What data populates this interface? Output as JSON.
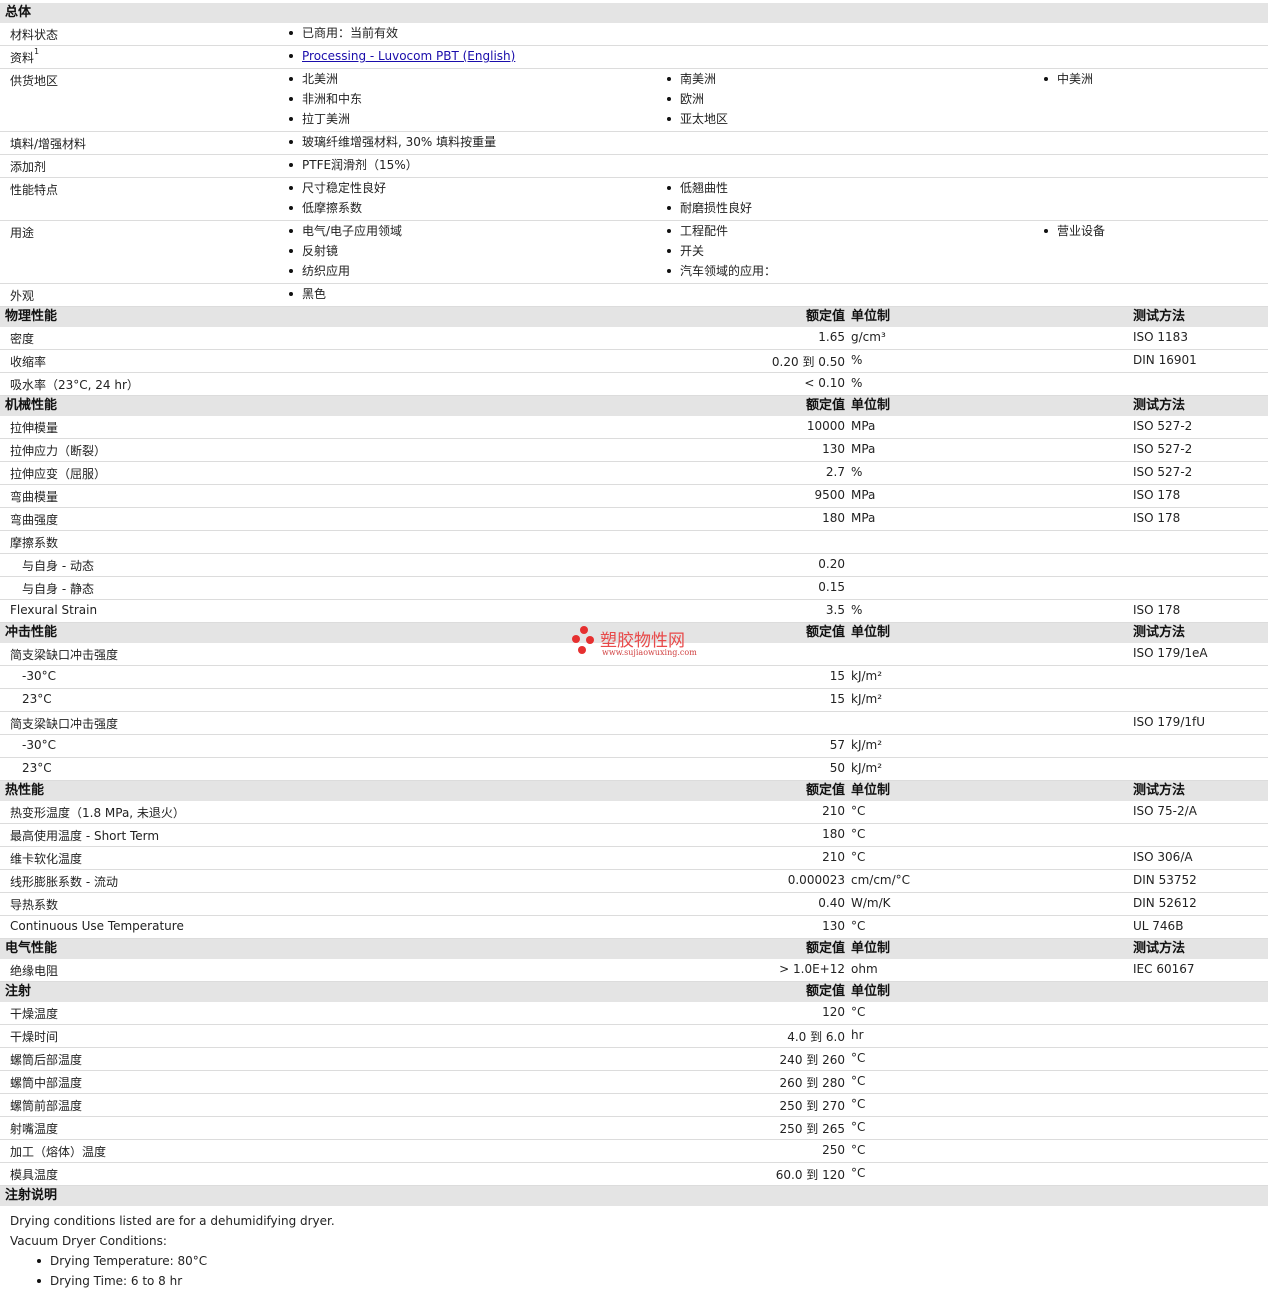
{
  "general": {
    "title": "总体",
    "rows": [
      {
        "label": "材料状态",
        "cols": [
          [
            "已商用：当前有效"
          ]
        ]
      },
      {
        "label": "资料",
        "sup": "1",
        "link": "Processing - Luvocom PBT (English)"
      },
      {
        "label": "供货地区",
        "cols": [
          [
            "北美洲",
            "非洲和中东",
            "拉丁美洲"
          ],
          [
            "南美洲",
            "欧洲",
            "亚太地区"
          ],
          [
            "中美洲"
          ]
        ]
      },
      {
        "label": "填料/增强材料",
        "cols": [
          [
            "玻璃纤维增强材料, 30% 填料按重量"
          ]
        ]
      },
      {
        "label": "添加剂",
        "cols": [
          [
            "PTFE润滑剂（15%）"
          ]
        ]
      },
      {
        "label": "性能特点",
        "cols": [
          [
            "尺寸稳定性良好",
            "低摩擦系数"
          ],
          [
            "低翘曲性",
            "耐磨损性良好"
          ]
        ]
      },
      {
        "label": "用途",
        "cols": [
          [
            "电气/电子应用领域",
            "反射镜",
            "纺织应用"
          ],
          [
            "工程配件",
            "开关",
            "汽车领域的应用："
          ],
          [
            "营业设备"
          ]
        ]
      },
      {
        "label": "外观",
        "cols": [
          [
            "黑色"
          ]
        ]
      }
    ]
  },
  "sections": [
    {
      "title": "物理性能",
      "hv": "额定值",
      "hu": "单位制",
      "hm": "测试方法",
      "rows": [
        {
          "label": "密度",
          "value": "1.65",
          "unit": "g/cm³",
          "method": "ISO 1183"
        },
        {
          "label": "收缩率",
          "value": "0.20 到 0.50",
          "unit": "%",
          "method": "DIN 16901"
        },
        {
          "label": "吸水率（23°C, 24 hr）",
          "value": "< 0.10",
          "unit": "%",
          "method": ""
        }
      ]
    },
    {
      "title": "机械性能",
      "hv": "额定值",
      "hu": "单位制",
      "hm": "测试方法",
      "rows": [
        {
          "label": "拉伸模量",
          "value": "10000",
          "unit": "MPa",
          "method": "ISO 527-2"
        },
        {
          "label": "拉伸应力（断裂）",
          "value": "130",
          "unit": "MPa",
          "method": "ISO 527-2"
        },
        {
          "label": "拉伸应变（屈服）",
          "value": "2.7",
          "unit": "%",
          "method": "ISO 527-2"
        },
        {
          "label": "弯曲模量",
          "value": "9500",
          "unit": "MPa",
          "method": "ISO 178"
        },
        {
          "label": "弯曲强度",
          "value": "180",
          "unit": "MPa",
          "method": "ISO 178"
        },
        {
          "label": "摩擦系数",
          "value": "",
          "unit": "",
          "method": ""
        },
        {
          "label": "与自身 - 动态",
          "indent": true,
          "value": "0.20",
          "unit": "",
          "method": ""
        },
        {
          "label": "与自身 - 静态",
          "indent": true,
          "value": "0.15",
          "unit": "",
          "method": ""
        },
        {
          "label": "Flexural Strain",
          "value": "3.5",
          "unit": "%",
          "method": "ISO 178"
        }
      ]
    },
    {
      "title": "冲击性能",
      "hv": "额定值",
      "hu": "单位制",
      "hm": "测试方法",
      "rows": [
        {
          "label": "简支梁缺口冲击强度",
          "value": "",
          "unit": "",
          "method": "ISO 179/1eA"
        },
        {
          "label": "-30°C",
          "indent": true,
          "value": "15",
          "unit": "kJ/m²",
          "method": ""
        },
        {
          "label": "23°C",
          "indent": true,
          "value": "15",
          "unit": "kJ/m²",
          "method": ""
        },
        {
          "label": "简支梁缺口冲击强度",
          "value": "",
          "unit": "",
          "method": "ISO 179/1fU"
        },
        {
          "label": "-30°C",
          "indent": true,
          "value": "57",
          "unit": "kJ/m²",
          "method": ""
        },
        {
          "label": "23°C",
          "indent": true,
          "value": "50",
          "unit": "kJ/m²",
          "method": ""
        }
      ]
    },
    {
      "title": "热性能",
      "hv": "额定值",
      "hu": "单位制",
      "hm": "测试方法",
      "rows": [
        {
          "label": "热变形温度（1.8 MPa, 未退火）",
          "value": "210",
          "unit": "°C",
          "method": "ISO 75-2/A"
        },
        {
          "label": "最高使用温度 - Short Term",
          "value": "180",
          "unit": "°C",
          "method": ""
        },
        {
          "label": "维卡软化温度",
          "value": "210",
          "unit": "°C",
          "method": "ISO 306/A"
        },
        {
          "label": "线形膨胀系数 - 流动",
          "value": "0.000023",
          "unit": "cm/cm/°C",
          "method": "DIN 53752"
        },
        {
          "label": "导热系数",
          "value": "0.40",
          "unit": "W/m/K",
          "method": "DIN 52612"
        },
        {
          "label": "Continuous Use Temperature",
          "value": "130",
          "unit": "°C",
          "method": "UL 746B"
        }
      ]
    },
    {
      "title": "电气性能",
      "hv": "额定值",
      "hu": "单位制",
      "hm": "测试方法",
      "rows": [
        {
          "label": "绝缘电阻",
          "value": "> 1.0E+12",
          "unit": "ohm",
          "method": "IEC 60167"
        }
      ]
    },
    {
      "title": "注射",
      "hv": "额定值",
      "hu": "单位制",
      "hm": "",
      "rows": [
        {
          "label": "干燥温度",
          "value": "120",
          "unit": "°C",
          "method": ""
        },
        {
          "label": "干燥时间",
          "value": "4.0 到 6.0",
          "unit": "hr",
          "method": ""
        },
        {
          "label": "螺筒后部温度",
          "value": "240 到 260",
          "unit": "°C",
          "method": ""
        },
        {
          "label": "螺筒中部温度",
          "value": "260 到 280",
          "unit": "°C",
          "method": ""
        },
        {
          "label": "螺筒前部温度",
          "value": "250 到 270",
          "unit": "°C",
          "method": ""
        },
        {
          "label": "射嘴温度",
          "value": "250 到 265",
          "unit": "°C",
          "method": ""
        },
        {
          "label": "加工（熔体）温度",
          "value": "250",
          "unit": "°C",
          "method": ""
        },
        {
          "label": "模具温度",
          "value": "60.0 到 120",
          "unit": "°C",
          "method": ""
        }
      ]
    }
  ],
  "notes": {
    "title": "注射说明",
    "lines": [
      "Drying conditions listed are for a dehumidifying dryer.",
      "Vacuum Dryer Conditions:"
    ],
    "bullets": [
      "Drying Temperature: 80°C",
      "Drying Time: 6 to 8 hr"
    ]
  },
  "watermark": {
    "text": "塑胶物性网",
    "url": "www.sujiaowuxing.com",
    "color": "#e63030"
  }
}
